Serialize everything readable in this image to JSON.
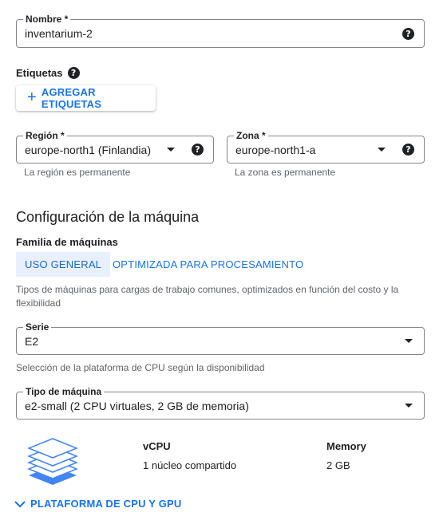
{
  "name_field": {
    "label": "Nombre *",
    "value": "inventarium-2"
  },
  "labels_section": {
    "title": "Etiquetas",
    "add_button": "AGREGAR ETIQUETAS"
  },
  "region_field": {
    "label": "Región *",
    "value": "europe-north1 (Finlandia)",
    "hint": "La región es permanente"
  },
  "zone_field": {
    "label": "Zona *",
    "value": "europe-north1-a",
    "hint": "La zona es permanente"
  },
  "machine_config": {
    "title": "Configuración de la máquina",
    "family_label": "Familia de máquinas",
    "tabs": [
      {
        "label": "USO GENERAL",
        "active": true
      },
      {
        "label": "OPTIMIZADA PARA PROCESAMIENTO",
        "active": false
      }
    ],
    "family_description": "Tipos de máquinas para cargas de trabajo comunes, optimizados en función del costo y la flexibilidad"
  },
  "series_field": {
    "label": "Serie",
    "value": "E2",
    "hint": "Selección de la plataforma de CPU según la disponibilidad"
  },
  "machine_type_field": {
    "label": "Tipo de máquina",
    "value": "e2-small (2 CPU virtuales, 2 GB de memoria)"
  },
  "specs": {
    "vcpu_label": "vCPU",
    "vcpu_value": "1 núcleo compartido",
    "memory_label": "Memory",
    "memory_value": "2 GB"
  },
  "cpu_platform_link": "PLATAFORMA DE CPU Y GPU",
  "colors": {
    "accent": "#1a73e8",
    "tab_active_bg": "#e8f0fe",
    "border": "#80868b",
    "hint": "#5f6368"
  }
}
